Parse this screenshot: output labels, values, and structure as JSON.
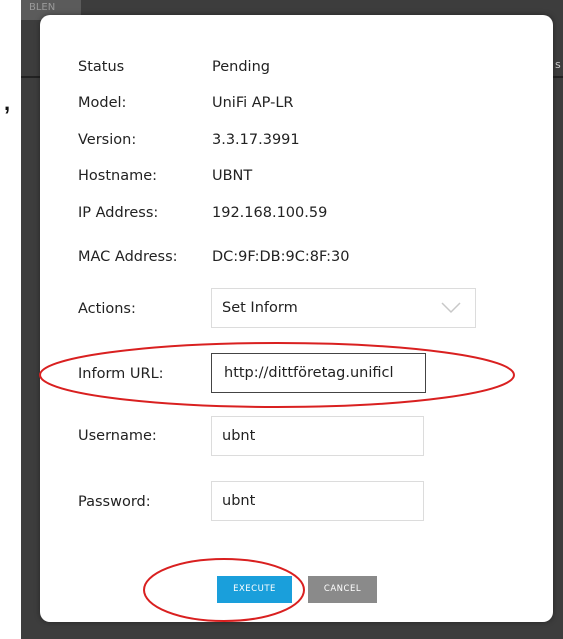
{
  "background": {
    "top_strip_text": "BLEN",
    "right_glyph": "s"
  },
  "dialog": {
    "fields": [
      {
        "label": "Status",
        "value": "Pending"
      },
      {
        "label": "Model:",
        "value": "UniFi AP-LR"
      },
      {
        "label": "Version:",
        "value": "3.3.17.3991"
      },
      {
        "label": "Hostname:",
        "value": "UBNT"
      },
      {
        "label": "IP Address:",
        "value": "192.168.100.59"
      },
      {
        "label": "MAC Address:",
        "value": "DC:9F:DB:9C:8F:30"
      }
    ],
    "actions": {
      "label": "Actions:",
      "selected": "Set Inform",
      "icon": "chevron-down-icon"
    },
    "inform_url": {
      "label": "Inform URL:",
      "value": "http://dittföretag.unificl"
    },
    "username": {
      "label": "Username:",
      "value": "ubnt"
    },
    "password": {
      "label": "Password:",
      "value": "ubnt"
    },
    "buttons": {
      "execute": "EXECUTE",
      "cancel": "CANCEL"
    }
  },
  "colors": {
    "accent": "#1a9fdb",
    "cancel": "#8a8a8a",
    "annotation": "#d92020",
    "overlay": "#3d3d3d"
  }
}
